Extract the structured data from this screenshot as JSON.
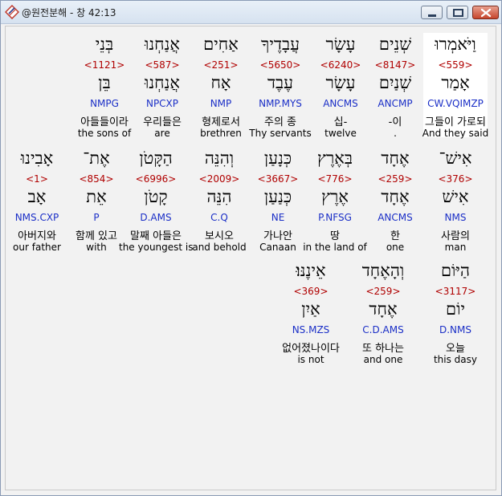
{
  "window": {
    "title": "@원전분해 - 창 42:13",
    "app_icon": "hebrew-lexicon-app-icon",
    "controls": {
      "minimize": "minimize-icon",
      "maximize": "maximize-icon",
      "close": "close-icon"
    }
  },
  "rows": [
    {
      "words": [
        {
          "heb": "וַיֹּאמְרוּ",
          "strong": "<559>",
          "lemma": "אָמַר",
          "parse": "CW.VQIMZP",
          "kor": "그들이 가로되",
          "eng": "And they said",
          "highlight": true
        },
        {
          "heb": "שְׁנֵים",
          "strong": "<8147>",
          "lemma": "שְׁנַיִם",
          "parse": "ANCMP",
          "kor": "-이",
          "eng": "."
        },
        {
          "heb": "עָשָׂר",
          "strong": "<6240>",
          "lemma": "עָשָׂר",
          "parse": "ANCMS",
          "kor": "십-",
          "eng": "twelve"
        },
        {
          "heb": "עֲבָדֶיךָ",
          "strong": "<5650>",
          "lemma": "עֶבֶד",
          "parse": "NMP.MYS",
          "kor": "주의 종",
          "eng": "Thy servants"
        },
        {
          "heb": "אַחִים",
          "strong": "<251>",
          "lemma": "אָח",
          "parse": "NMP",
          "kor": "형제로서",
          "eng": "brethren"
        },
        {
          "heb": "אֲנַחְנוּ",
          "strong": "<587>",
          "lemma": "אֲנַחְנוּ",
          "parse": "NPCXP",
          "kor": "우리들은",
          "eng": "are"
        },
        {
          "heb": "בְּנֵי",
          "strong": "<1121>",
          "lemma": "בֵּן",
          "parse": "NMPG",
          "kor": "아들들이라",
          "eng": "the sons of"
        }
      ]
    },
    {
      "words": [
        {
          "heb": "אִישׁ־",
          "strong": "<376>",
          "lemma": "אִישׁ",
          "parse": "NMS",
          "kor": "사람의",
          "eng": "man"
        },
        {
          "heb": "אֶחָד",
          "strong": "<259>",
          "lemma": "אֶחָד",
          "parse": "ANCMS",
          "kor": "한",
          "eng": "one"
        },
        {
          "heb": "בְּאֶרֶץ",
          "strong": "<776>",
          "lemma": "אֶרֶץ",
          "parse": "P.NFSG",
          "kor": "땅",
          "eng": "in the land of"
        },
        {
          "heb": "כְּנָעַן",
          "strong": "<3667>",
          "lemma": "כְּנַעַן",
          "parse": "NE",
          "kor": "가나안",
          "eng": "Canaan"
        },
        {
          "heb": "וְהִנֵּה",
          "strong": "<2009>",
          "lemma": "הִנֵּה",
          "parse": "C.Q",
          "kor": "보시오",
          "eng": "and behold"
        },
        {
          "heb": "הַקָּטֹן",
          "strong": "<6996>",
          "lemma": "קָטֹן",
          "parse": "D.AMS",
          "kor": "말째 아들은",
          "eng": "the youngest is"
        },
        {
          "heb": "אֶת־",
          "strong": "<854>",
          "lemma": "אֵת",
          "parse": "P",
          "kor": "함께 있고",
          "eng": "with"
        },
        {
          "heb": "אָבִינוּ",
          "strong": "<1>",
          "lemma": "אָב",
          "parse": "NMS.CXP",
          "kor": "아버지와",
          "eng": "our father"
        }
      ]
    },
    {
      "words": [
        {
          "heb": "הַיּוֹם",
          "strong": "<3117>",
          "lemma": "יוֹם",
          "parse": "D.NMS",
          "kor": "오늘",
          "eng": "this dasy"
        },
        {
          "heb": "וְהָאֶחָד",
          "strong": "<259>",
          "lemma": "אֶחָד",
          "parse": "C.D.AMS",
          "kor": "또 하나는",
          "eng": "and one"
        },
        {
          "heb": "אֵינֶנּוּ׃",
          "strong": "<369>",
          "lemma": "אַיִן",
          "parse": "NS.MZS",
          "kor": "없어졌나이다",
          "eng": "is not"
        }
      ]
    }
  ]
}
